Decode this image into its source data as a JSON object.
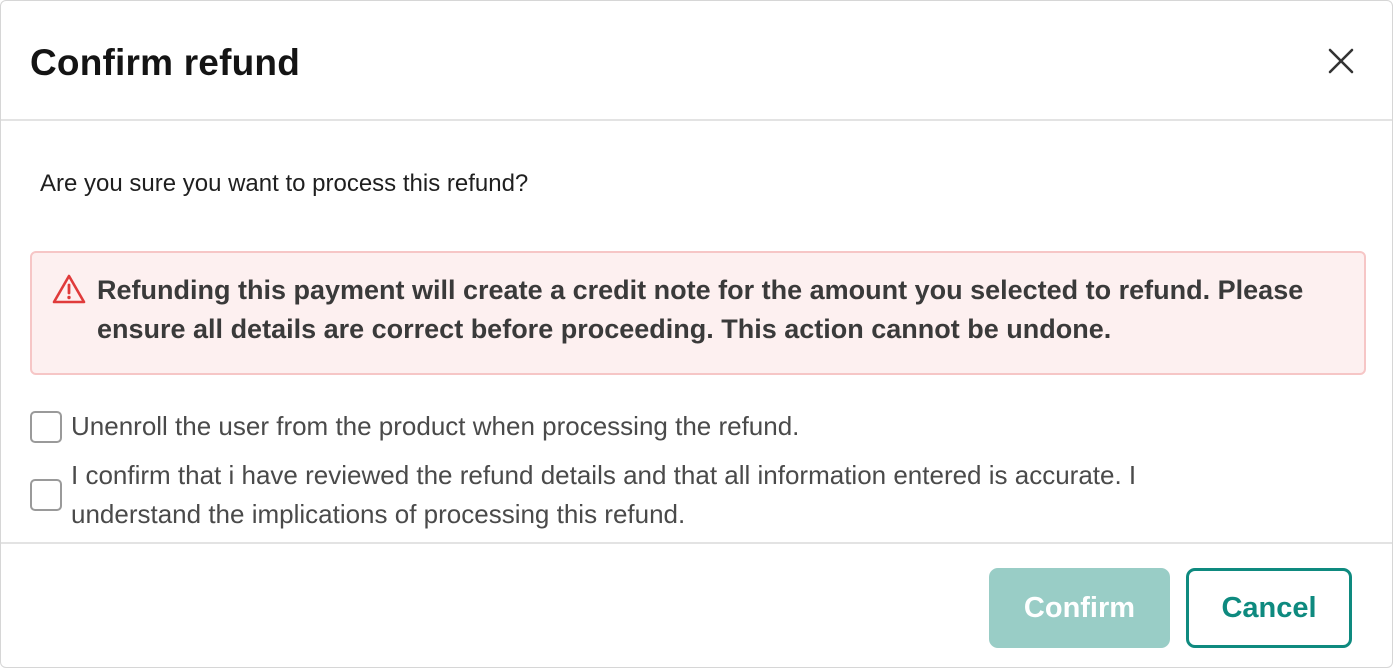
{
  "dialog": {
    "title": "Confirm refund",
    "close_icon": "close-icon"
  },
  "body": {
    "question": "Are you sure you want to process this refund?",
    "alert": {
      "icon": "warning-triangle-icon",
      "color": "#e03b3b",
      "background": "#fdf0f0",
      "text": "Refunding this payment will create a credit note for the amount you selected to refund. Please ensure all details are correct before proceeding. This action cannot be undone."
    },
    "checkboxes": [
      {
        "label": "Unenroll the user from the product when processing the refund.",
        "checked": false
      },
      {
        "label": "I confirm that i have reviewed the refund details and that all information entered is accurate. I understand the implications of processing this refund.",
        "checked": false
      }
    ]
  },
  "footer": {
    "confirm_label": "Confirm",
    "confirm_disabled": true,
    "cancel_label": "Cancel",
    "accent_color": "#0e8a7f"
  }
}
